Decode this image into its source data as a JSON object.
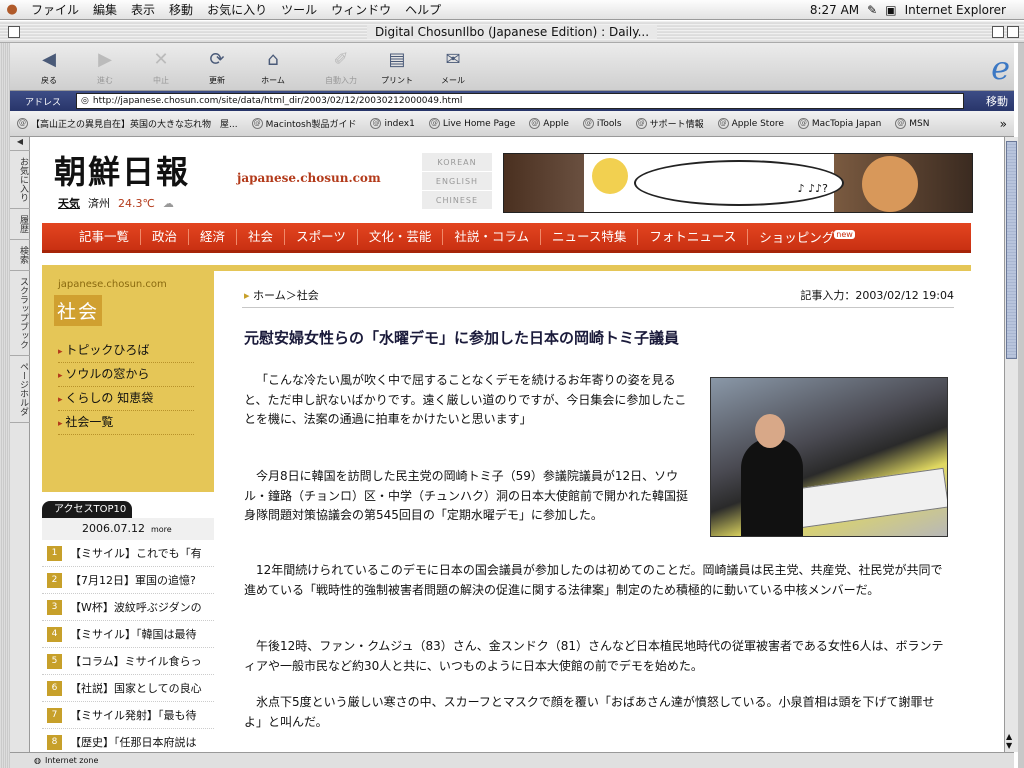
{
  "os_menubar": {
    "menus": [
      "ファイル",
      "編集",
      "表示",
      "移動",
      "お気に入り",
      "ツール",
      "ウィンドウ",
      "ヘルプ"
    ],
    "clock": "8:27 AM",
    "app_name": "Internet Explorer"
  },
  "window": {
    "title": "Digital ChosunIlbo (Japanese Edition) : Daily..."
  },
  "toolbar": {
    "buttons": [
      {
        "label": "戻る",
        "icon": "back-arrow-icon",
        "enabled": true
      },
      {
        "label": "進む",
        "icon": "forward-arrow-icon",
        "enabled": false
      },
      {
        "label": "中止",
        "icon": "stop-icon",
        "enabled": false
      },
      {
        "label": "更新",
        "icon": "refresh-icon",
        "enabled": true
      },
      {
        "label": "ホーム",
        "icon": "home-icon",
        "enabled": true
      },
      {
        "label": "自動入力",
        "icon": "autofill-icon",
        "enabled": false
      },
      {
        "label": "プリント",
        "icon": "print-icon",
        "enabled": true
      },
      {
        "label": "メール",
        "icon": "mail-icon",
        "enabled": true
      }
    ]
  },
  "address_bar": {
    "label": "アドレス",
    "url": "http://japanese.chosun.com/site/data/html_dir/2003/02/12/20030212000049.html",
    "go_label": "移動"
  },
  "favorites": [
    "【高山正之の異見自在】英国の大きな忘れ物　屋...",
    "Macintosh製品ガイド",
    "index1",
    "Live Home Page",
    "Apple",
    "iTools",
    "サポート情報",
    "Apple Store",
    "MacTopia Japan",
    "MSN"
  ],
  "side_tabs": [
    "お気に入り",
    "履歴",
    "検索",
    "スクラップブック",
    "ページホルダ"
  ],
  "status": {
    "zone": "Internet zone"
  },
  "site": {
    "logo": "朝鮮日報",
    "domain": "japanese.chosun.com",
    "weather_label": "天気",
    "weather_city": "済州",
    "weather_temp": "24.3℃",
    "languages": [
      "KOREAN",
      "ENGLISH",
      "CHINESE"
    ],
    "banner_text": "♪ ♪♪?",
    "nav": [
      "記事一覧",
      "政治",
      "経済",
      "社会",
      "スポーツ",
      "文化・芸能",
      "社説・コラム",
      "ニュース特集",
      "フォトニュース",
      "ショッピング"
    ],
    "nav_new_badge": "new"
  },
  "sidebar": {
    "brand": "japanese.chosun.com",
    "section": "社会",
    "links": [
      "トピックひろば",
      "ソウルの窓から",
      "くらしの 知恵袋",
      "社会一覧"
    ],
    "access_title": "アクセスTOP10",
    "access_date": "2006.07.12",
    "access_more": "more",
    "ranking": [
      {
        "n": "1",
        "text": "【ミサイル】これでも「有"
      },
      {
        "n": "2",
        "text": "【7月12日】軍国の追憶?"
      },
      {
        "n": "3",
        "text": "【W杯】波紋呼ぶジダンの"
      },
      {
        "n": "4",
        "text": "【ミサイル】「韓国は最待"
      },
      {
        "n": "5",
        "text": "【コラム】ミサイル食らっ"
      },
      {
        "n": "6",
        "text": "【社説】国家としての良心"
      },
      {
        "n": "7",
        "text": "【ミサイル発射】「最も待"
      },
      {
        "n": "8",
        "text": "【歴史】「任那日本府説は"
      }
    ]
  },
  "article": {
    "breadcrumb": "ホーム＞社会",
    "posted": "記事入力：2003/02/12 19:04",
    "headline": "元慰安婦女性らの「水曜デモ」に参加した日本の岡崎トミ子議員",
    "paragraphs": [
      "「こんな冷たい風が吹く中で屈することなくデモを続けるお年寄りの姿を見ると、ただ申し訳ないばかりです。遠く厳しい道のりですが、今日集会に参加したことを機に、法案の通過に拍車をかけたいと思います」",
      "今月8日に韓国を訪問した民主党の岡崎トミ子（59）参議院議員が12日、ソウル・鐘路（チョンロ）区・中学（チュンハク）洞の日本大使館前で開かれた韓国挺身隊問題対策協議会の第545回目の「定期水曜デモ」に参加した。",
      "12年間続けられているこのデモに日本の国会議員が参加したのは初めてのことだ。岡崎議員は民主党、共産党、社民党が共同で進めている「戦時性的強制被害者問題の解決の促進に関する法律案」制定のため積極的に動いている中核メンバーだ。",
      "午後12時、ファン・クムジュ（83）さん、金スンドク（81）さんなど日本植民地時代の従軍被害者である女性6人は、ボランティアや一般市民など約30人と共に、いつものように日本大使館の前でデモを始めた。",
      "氷点下5度という厳しい寒さの中、スカーフとマスクで顔を覆い「おばあさん達が憤怒している。小泉首相は頭を下げて謝罪せよ」と叫んだ。"
    ]
  }
}
